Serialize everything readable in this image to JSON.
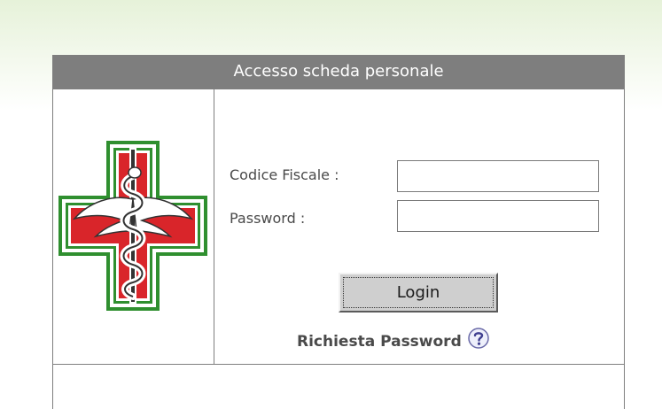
{
  "login_panel": {
    "header_title": "Accesso scheda personale",
    "logo_icon": "pharmacy-cross-caduceus-icon",
    "fields": {
      "codice_fiscale": {
        "label": "Codice Fiscale :",
        "value": "",
        "placeholder": ""
      },
      "password": {
        "label": "Password :",
        "value": "",
        "placeholder": ""
      }
    },
    "login_button_label": "Login",
    "password_request_label": "Richiesta Password",
    "help_icon": "question-mark-icon"
  },
  "colors": {
    "header_background": "#7e7e7e",
    "header_text": "#ffffff",
    "cross_red": "#d9252a",
    "cross_green": "#2f8f2f",
    "top_band": "#e6f2d9"
  }
}
